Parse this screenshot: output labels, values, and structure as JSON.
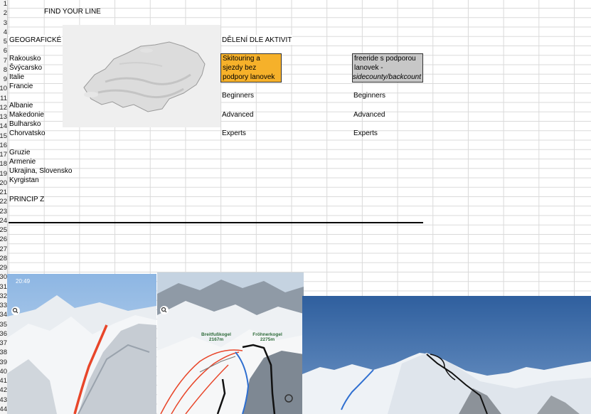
{
  "sheet": {
    "row_numbers": [
      "1",
      "2",
      "3",
      "4",
      "5",
      "6",
      "7",
      "8",
      "9",
      "10",
      "11",
      "12",
      "13",
      "14",
      "15",
      "16",
      "17",
      "18",
      "19",
      "20",
      "21",
      "22",
      "23",
      "24",
      "25",
      "26",
      "27",
      "28",
      "29",
      "30",
      "31",
      "32",
      "33",
      "34",
      "35",
      "36",
      "37",
      "38",
      "39",
      "40",
      "41",
      "42",
      "43",
      "44"
    ]
  },
  "cells": {
    "title": "FIND YOUR LINE",
    "geo_header": "GEOGRAFICKÉ",
    "activity_header": "DĚLENÍ DLE AKTIVIT",
    "countries": [
      "Rakousko",
      "Švýcarsko",
      "Italie",
      "Francie",
      "",
      "Albanie",
      "Makedonie",
      "Bulharsko",
      "Chorvatsko",
      "",
      "Gruzie",
      "Armenie",
      "Ukrajina, Slovensko",
      "Kyrgistan"
    ],
    "principle": "PRINCIP Z",
    "skitouring_box": [
      "Skitouring a",
      "sjezdy bez",
      "podpory lanovek"
    ],
    "freeride_box": [
      "freeride s podporou",
      "lanovek -",
      "sidecounty/backcount"
    ],
    "levels_left": [
      "Beginners",
      "Advanced",
      "Experts"
    ],
    "levels_right": [
      "Beginners",
      "Advanced",
      "Experts"
    ]
  },
  "images": {
    "phone_time": "20:49",
    "label_peak_a": "Breitfußkogel 2167m",
    "label_peak_b": "Fröhnerkogel 2275m"
  },
  "colors": {
    "orange_fill": "#f6b12a",
    "grey_fill": "#c7c7c7",
    "route_red": "#e8462a",
    "route_blue": "#2f6fd0"
  }
}
